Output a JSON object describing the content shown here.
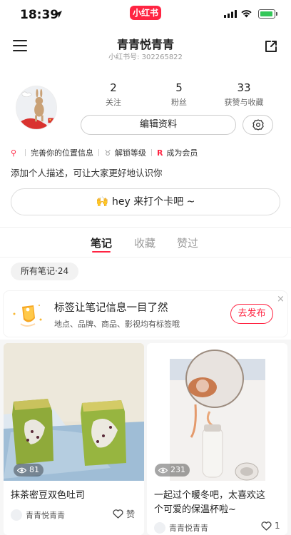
{
  "status_bar": {
    "time": "18:39",
    "app_badge": "小红书"
  },
  "header": {
    "title": "青青悦青青",
    "subtitle": "小红书号: 302265822"
  },
  "profile": {
    "stats": [
      {
        "value": "2",
        "label": "关注"
      },
      {
        "value": "5",
        "label": "粉丝"
      },
      {
        "value": "33",
        "label": "获赞与收藏"
      }
    ],
    "edit_label": "编辑资料",
    "tags": [
      "完善你的位置信息",
      "解锁等级",
      "成为会员"
    ],
    "bio": "添加个人描述，可让大家更好地认识你",
    "checkin": "hey 来打个卡吧 ~"
  },
  "tabs": [
    {
      "label": "笔记",
      "active": true
    },
    {
      "label": "收藏",
      "active": false
    },
    {
      "label": "赞过",
      "active": false
    }
  ],
  "filter_label": "所有笔记·24",
  "promo": {
    "title": "标签让笔记信息一目了然",
    "desc": "地点、品牌、商品、影视均有标签哦",
    "button": "去发布",
    "close": "×"
  },
  "notes": [
    {
      "views": "81",
      "title": "抹茶密豆双色吐司",
      "author": "青青悦青青",
      "likes": "赞"
    },
    {
      "views": "231",
      "title_line1": "一起过个暖冬吧，太喜欢这",
      "title_line2": "个可爱的保温杯啦~",
      "author": "青青悦青青",
      "likes": "1"
    }
  ],
  "colors": {
    "accent": "#ff2442",
    "battery": "#34c759"
  }
}
